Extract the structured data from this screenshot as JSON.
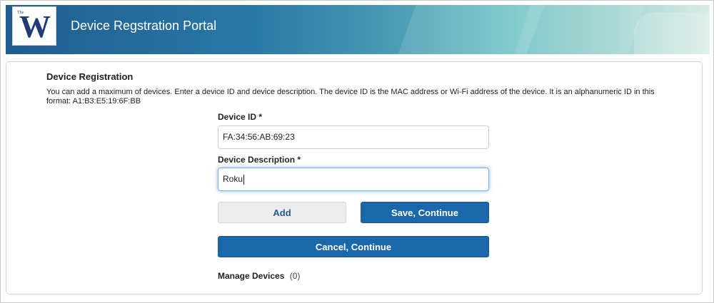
{
  "header": {
    "logo_small": "The",
    "logo_letter": "W",
    "title": "Device Regstration Portal"
  },
  "registration": {
    "title": "Device Registration",
    "description": "You can add a maximum of devices. Enter a device ID and device description. The device ID is the MAC address or Wi-Fi address of the device. It is an alphanumeric ID in this format: A1:B3:E5:19:6F:BB",
    "device_id_label": "Device ID *",
    "device_id_value": "FA:34:56:AB:69:23",
    "device_desc_label": "Device Description *",
    "device_desc_value": "Roku",
    "add_label": "Add",
    "save_label": "Save, Continue",
    "cancel_label": "Cancel, Continue",
    "manage_label": "Manage Devices",
    "manage_count": "(0)"
  },
  "colors": {
    "primary": "#1a68a8",
    "header_start": "#1f5d8f",
    "header_end": "#d9ece6",
    "focus_glow": "#3c8ce6"
  }
}
